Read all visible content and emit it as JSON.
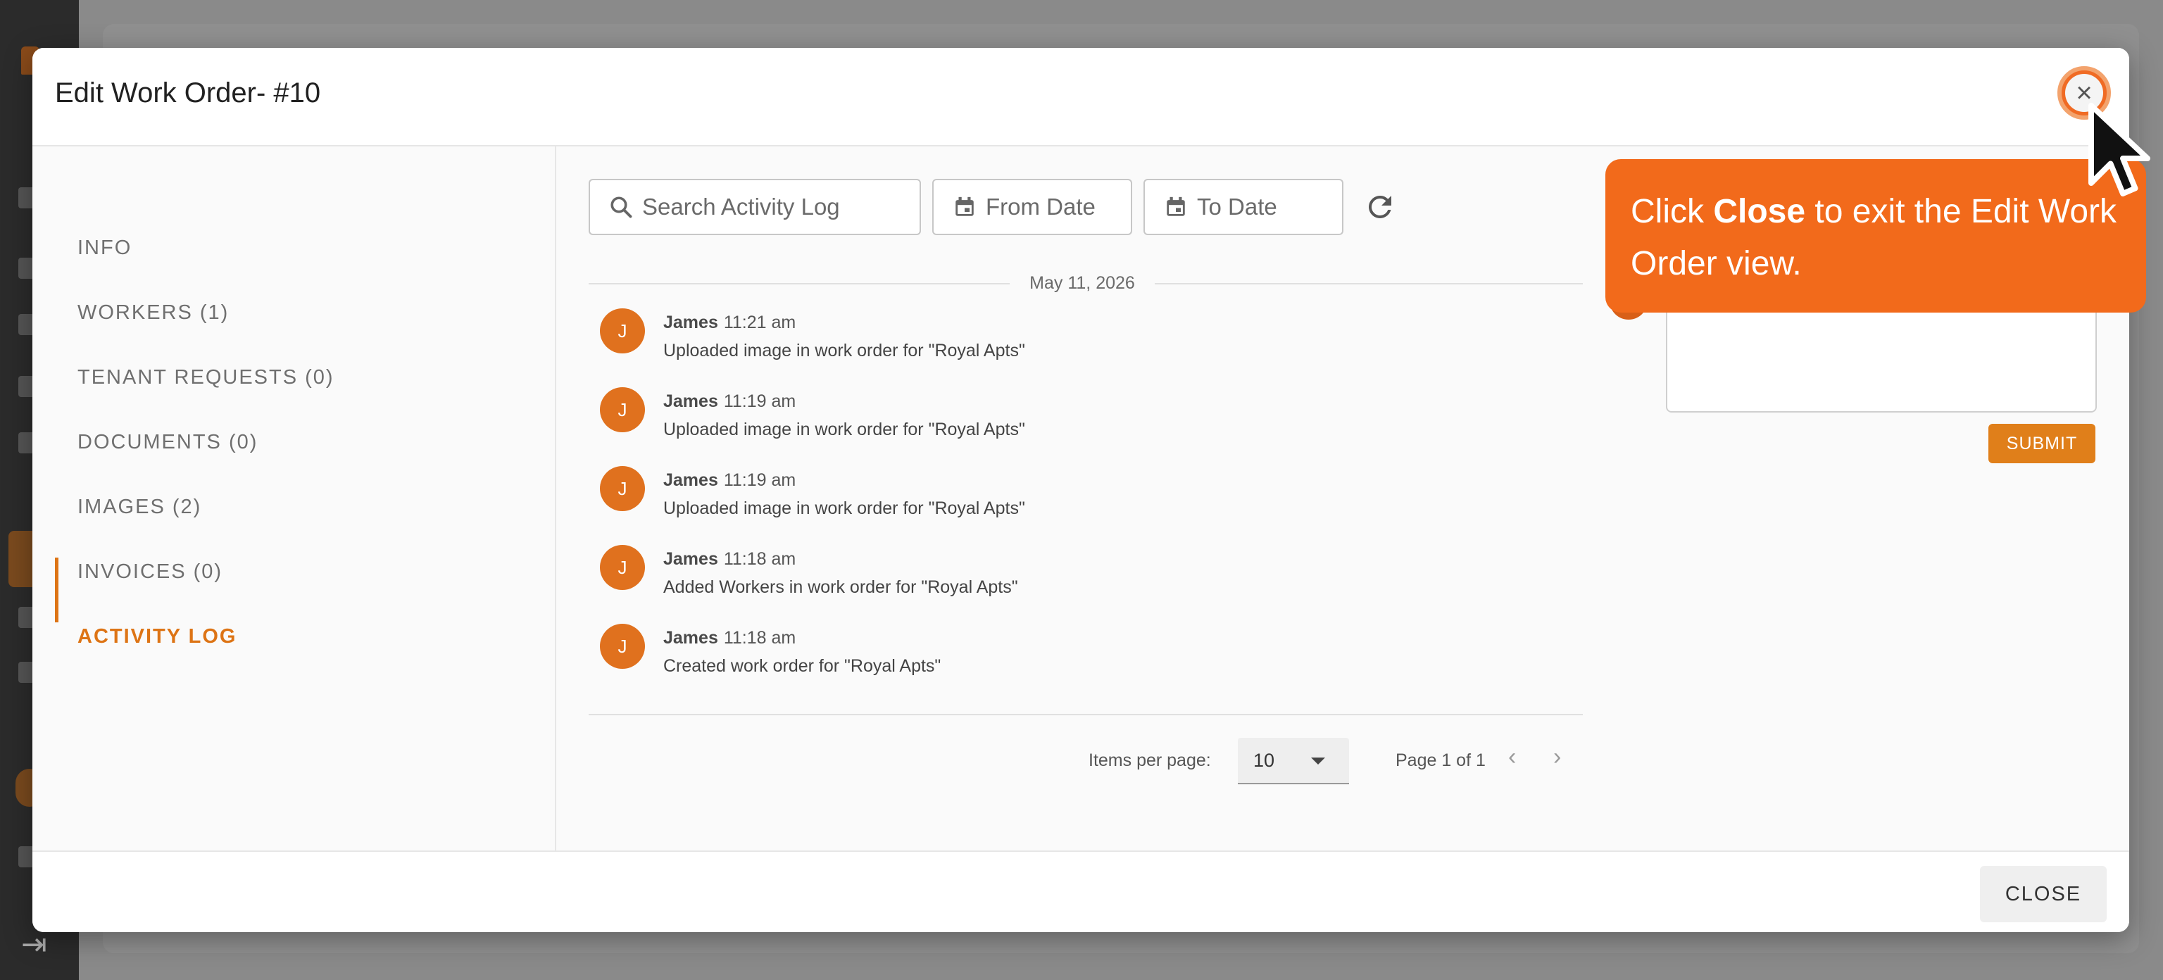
{
  "modal": {
    "title": "Edit Work Order- #10",
    "close_label": "CLOSE"
  },
  "nav": {
    "items": [
      {
        "label": "INFO"
      },
      {
        "label": "WORKERS (1)"
      },
      {
        "label": "TENANT REQUESTS (0)"
      },
      {
        "label": "DOCUMENTS (0)"
      },
      {
        "label": "IMAGES (2)"
      },
      {
        "label": "INVOICES (0)"
      },
      {
        "label": "ACTIVITY LOG"
      }
    ],
    "active": "ACTIVITY LOG"
  },
  "filters": {
    "search_placeholder": "Search Activity Log",
    "from_placeholder": "From Date",
    "to_placeholder": "To Date"
  },
  "log": {
    "date": "May 11, 2026",
    "entries": [
      {
        "initial": "J",
        "name": "James",
        "time": "11:21 am",
        "text": "Uploaded image in work order for \"Royal Apts\""
      },
      {
        "initial": "J",
        "name": "James",
        "time": "11:19 am",
        "text": "Uploaded image in work order for \"Royal Apts\""
      },
      {
        "initial": "J",
        "name": "James",
        "time": "11:19 am",
        "text": "Uploaded image in work order for \"Royal Apts\""
      },
      {
        "initial": "J",
        "name": "James",
        "time": "11:18 am",
        "text": "Added Workers in work order for \"Royal Apts\""
      },
      {
        "initial": "J",
        "name": "James",
        "time": "11:18 am",
        "text": "Created work order for \"Royal Apts\""
      }
    ]
  },
  "pager": {
    "items_label": "Items per page:",
    "items_value": "10",
    "page_label": "Page 1 of 1"
  },
  "comment": {
    "submit_label": "SUBMIT"
  },
  "tooltip": {
    "prefix": "Click ",
    "bold": "Close",
    "suffix": " to exit the Edit Work Order view."
  },
  "colors": {
    "accent": "#dd7415",
    "tooltip": "#f26a1b",
    "avatar": "#e0711e"
  }
}
